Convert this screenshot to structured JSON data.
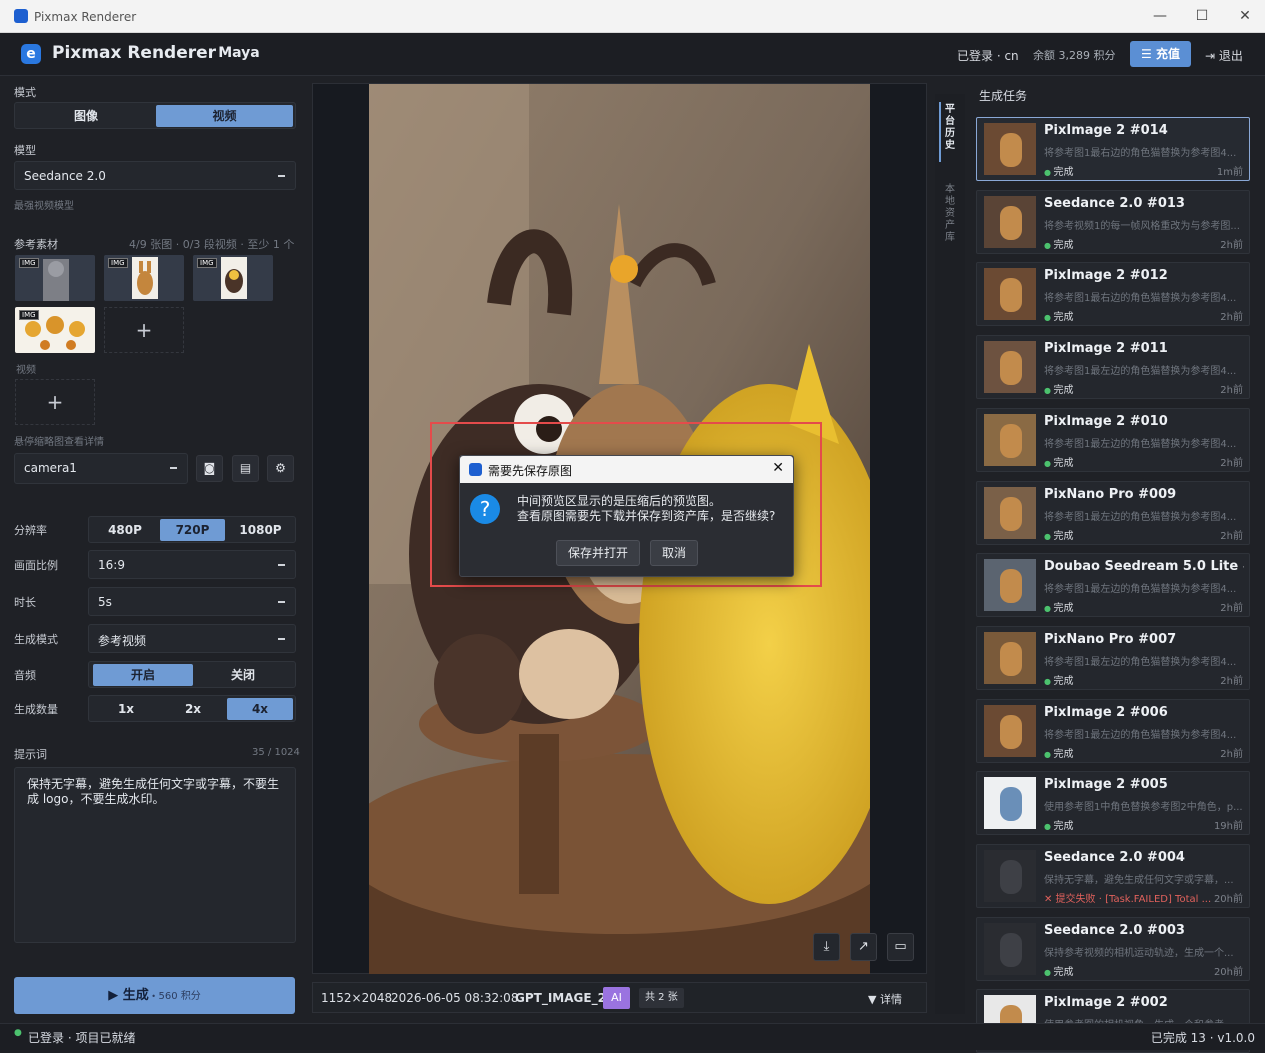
{
  "window": {
    "title": "Pixmax Renderer",
    "min": "—",
    "max": "☐",
    "close": "✕"
  },
  "header": {
    "app_name": "Pixmax Renderer",
    "project": "· Maya",
    "login": "已登录 · cn",
    "balance": "余额 3,289 积分",
    "recharge": "充值",
    "logout": "退出"
  },
  "left": {
    "mode_label": "模式",
    "mode_options": [
      "图像",
      "视频"
    ],
    "mode_selected": "视频",
    "model_label": "模型",
    "model_value": "Seedance 2.0",
    "model_hint": "最强视频模型",
    "ref_label": "参考素材",
    "ref_count": "4/9 张图 · 0/3 段视频 · 至少 1 个",
    "img_tag": "IMG",
    "video_label": "视频",
    "hover_hint": "悬停缩略图查看详情",
    "camera_value": "camera1",
    "resolution_label": "分辨率",
    "resolutions": [
      "480P",
      "720P",
      "1080P"
    ],
    "aspect_label": "画面比例",
    "aspect_value": "16:9",
    "duration_label": "时长",
    "duration_value": "5s",
    "genmode_label": "生成模式",
    "genmode_value": "参考视频",
    "audio_label": "音频",
    "audio_on": "开启",
    "audio_off": "关闭",
    "count_label": "生成数量",
    "counts": [
      "1x",
      "2x",
      "4x"
    ],
    "prompt_label": "提示词",
    "prompt_count": "35 / 1024",
    "prompt_text": "保持无字幕，避免生成任何文字或字幕，不要生成 logo，不要生成水印。",
    "generate": "生成",
    "generate_cost": "560 积分"
  },
  "center": {
    "resolution": "1152×2048",
    "datetime": "2026-06-05 08:32:08",
    "model": "GPT_IMAGE_2",
    "ai_badge": "AI",
    "count": "共 2 张",
    "details": "详情"
  },
  "dialog": {
    "title": "需要先保存原图",
    "line1": "中间预览区显示的是压缩后的预览图。",
    "line2": "查看原图需要先下载并保存到资产库，是否继续?",
    "confirm": "保存并打开",
    "cancel": "取消"
  },
  "side_tabs": [
    "平台历史",
    "本地资产库"
  ],
  "right": {
    "title": "生成任务",
    "tasks": [
      {
        "name": "PixImage 2 #014",
        "desc": "将参考图1最右边的角色猫替换为参考图4...",
        "status": "完成",
        "time": "1m前"
      },
      {
        "name": "Seedance 2.0 #013",
        "desc": "将参考视频1的每一帧风格重改为与参考图...",
        "status": "完成",
        "time": "2h前"
      },
      {
        "name": "PixImage 2 #012",
        "desc": "将参考图1最右边的角色猫替换为参考图4...",
        "status": "完成",
        "time": "2h前"
      },
      {
        "name": "PixImage 2 #011",
        "desc": "将参考图1最左边的角色猫替换为参考图4...",
        "status": "完成",
        "time": "2h前"
      },
      {
        "name": "PixImage 2 #010",
        "desc": "将参考图1最左边的角色猫替换为参考图4...",
        "status": "完成",
        "time": "2h前"
      },
      {
        "name": "PixNano Pro #009",
        "desc": "将参考图1最左边的角色猫替换为参考图4...",
        "status": "完成",
        "time": "2h前"
      },
      {
        "name": "Doubao Seedream 5.0 Lite #...",
        "desc": "将参考图1最左边的角色猫替换为参考图4...",
        "status": "完成",
        "time": "2h前"
      },
      {
        "name": "PixNano Pro #007",
        "desc": "将参考图1最左边的角色猫替换为参考图4...",
        "status": "完成",
        "time": "2h前"
      },
      {
        "name": "PixImage 2 #006",
        "desc": "将参考图1最左边的角色猫替换为参考图4...",
        "status": "完成",
        "time": "2h前"
      },
      {
        "name": "PixImage 2 #005",
        "desc": "使用参考图1中角色替换参考图2中角色，p...",
        "status": "完成",
        "time": "19h前"
      },
      {
        "name": "Seedance 2.0 #004",
        "desc": "保持无字幕，避免生成任何文字或字幕，...",
        "status": "✕ 提交失败 · [Task.FAILED] Total ...",
        "time": "20h前"
      },
      {
        "name": "Seedance 2.0 #003",
        "desc": "保持参考视频的相机运动轨迹，生成一个...",
        "status": "完成",
        "time": "20h前"
      },
      {
        "name": "PixImage 2 #002",
        "desc": "使用参考图的相机视角，生成一个和参考...",
        "status": "",
        "time": ""
      }
    ]
  },
  "status": {
    "left": "已登录 · 项目已就绪",
    "right": "已完成 13 · v1.0.0"
  }
}
